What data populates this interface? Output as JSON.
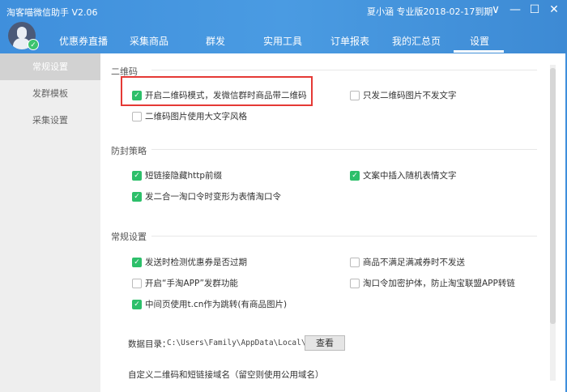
{
  "app": {
    "title": "淘客喵微信助手 V2.06",
    "user": "夏小涵 专业版2018-02-17到期"
  },
  "window": {
    "dropdown": "∨",
    "minimize": "—",
    "maximize": "☐",
    "close": "✕"
  },
  "tabs": [
    "优惠券直播",
    "采集商品",
    "群发",
    "实用工具",
    "订单报表",
    "我的汇总页",
    "设置"
  ],
  "active_tab": "设置",
  "sidebar": {
    "items": [
      "常规设置",
      "发群模板",
      "采集设置"
    ],
    "active": "常规设置"
  },
  "sections": {
    "qr": {
      "title": "二维码",
      "options": [
        {
          "label": "开启二维码模式，发微信群时商品带二维码",
          "checked": true
        },
        {
          "label": "只发二维码图片不发文字",
          "checked": false
        },
        {
          "label": "二维码图片使用大文字风格",
          "checked": false
        }
      ]
    },
    "anti": {
      "title": "防封策略",
      "options": [
        {
          "label": "短链接隐藏http前缀",
          "checked": true
        },
        {
          "label": "文案中插入随机表情文字",
          "checked": true
        },
        {
          "label": "发二合一淘口令时变形为表情淘口令",
          "checked": true
        }
      ]
    },
    "general": {
      "title": "常规设置",
      "options": [
        {
          "label": "发送时检测优惠券是否过期",
          "checked": true
        },
        {
          "label": "商品不满足满减券时不发送",
          "checked": false
        },
        {
          "label": "开启“手淘APP”发群功能",
          "checked": false
        },
        {
          "label": "淘口令加密护体，防止淘宝联盟APP转链",
          "checked": false
        },
        {
          "label": "中间页使用t.cn作为跳转(有商品图片)",
          "checked": true
        }
      ]
    }
  },
  "data_dir": {
    "label": "数据目录：",
    "path": "C:\\Users\\Family\\AppData\\Local\\Mi",
    "button": "查看"
  },
  "domain_label": "自定义二维码和短链接域名（留空则使用公用域名）"
}
